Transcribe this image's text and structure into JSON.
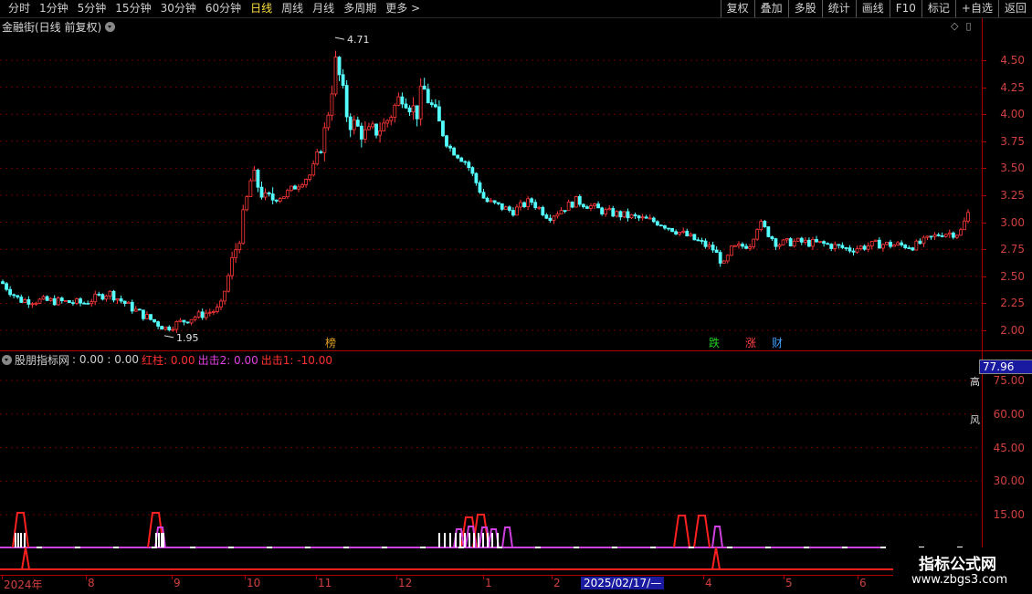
{
  "toolbar": {
    "periods": [
      "分时",
      "1分钟",
      "5分钟",
      "15分钟",
      "30分钟",
      "60分钟",
      "日线",
      "周线",
      "月线",
      "多周期",
      "更多 >"
    ],
    "active_period": "日线",
    "actions": [
      "复权",
      "叠加",
      "多股",
      "统计",
      "画线",
      "F10",
      "标记",
      "+自选",
      "返回"
    ]
  },
  "stock": {
    "title": "金融街(日线 前复权)"
  },
  "main_chart": {
    "price_labels": [
      "4.50",
      "4.25",
      "4.00",
      "3.75",
      "3.50",
      "3.25",
      "3.00",
      "2.75",
      "2.50",
      "2.25",
      "2.00"
    ],
    "high_label": "4.71",
    "low_label": "1.95",
    "markers": [
      {
        "text": "榜",
        "color": "#e0a020"
      },
      {
        "text": "跌",
        "color": "#20d020"
      },
      {
        "text": "涨",
        "color": "#ff4040"
      },
      {
        "text": "财",
        "color": "#40a0ff"
      }
    ]
  },
  "indicator": {
    "name": "股朋指标网",
    "values_text": ": 0.00 : 0.00",
    "hongzhu": "红柱: 0.00",
    "chuji2": "出击2: 0.00",
    "chuji1": "出击1: -10.00",
    "colors": {
      "hongzhu": "#ff3030",
      "chuji2": "#e040e0",
      "chuji1": "#ff3030"
    },
    "axis_labels": [
      "75.00",
      "60.00",
      "45.00",
      "30.00",
      "15.00"
    ],
    "current_value": "77.96",
    "side_icons": [
      "高",
      "风"
    ]
  },
  "date_axis": {
    "labels": [
      "2024年",
      "8",
      "9",
      "10",
      "11",
      "12",
      "1",
      "2",
      "4",
      "5",
      "6"
    ],
    "cursor_label": "2025/02/17/—"
  },
  "watermark": {
    "title": "指标公式网",
    "url": "www.zbgs3.com"
  }
}
